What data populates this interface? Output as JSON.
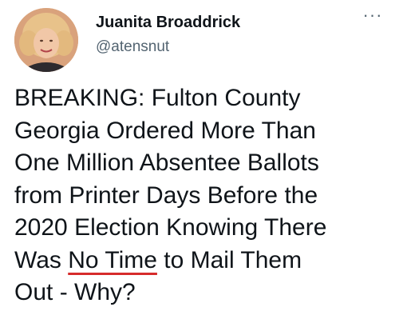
{
  "author": {
    "display_name": "Juanita Broaddrick",
    "handle": "@atensnut",
    "avatar_icon": "profile-photo"
  },
  "menu": {
    "more_label": "···",
    "icon": "more-horizontal-icon"
  },
  "tweet": {
    "lines": {
      "l1": "BREAKING: Fulton County",
      "l2": "Georgia Ordered More Than",
      "l3": "One Million Absentee Ballots",
      "l4": "from Printer Days Before the",
      "l5": "2020 Election Knowing There",
      "l6_pre": "Was ",
      "l6_mark": "No Time",
      "l6_post": " to Mail Them",
      "l7": "Out - Why?"
    },
    "highlight_color": "#d62b2b"
  }
}
